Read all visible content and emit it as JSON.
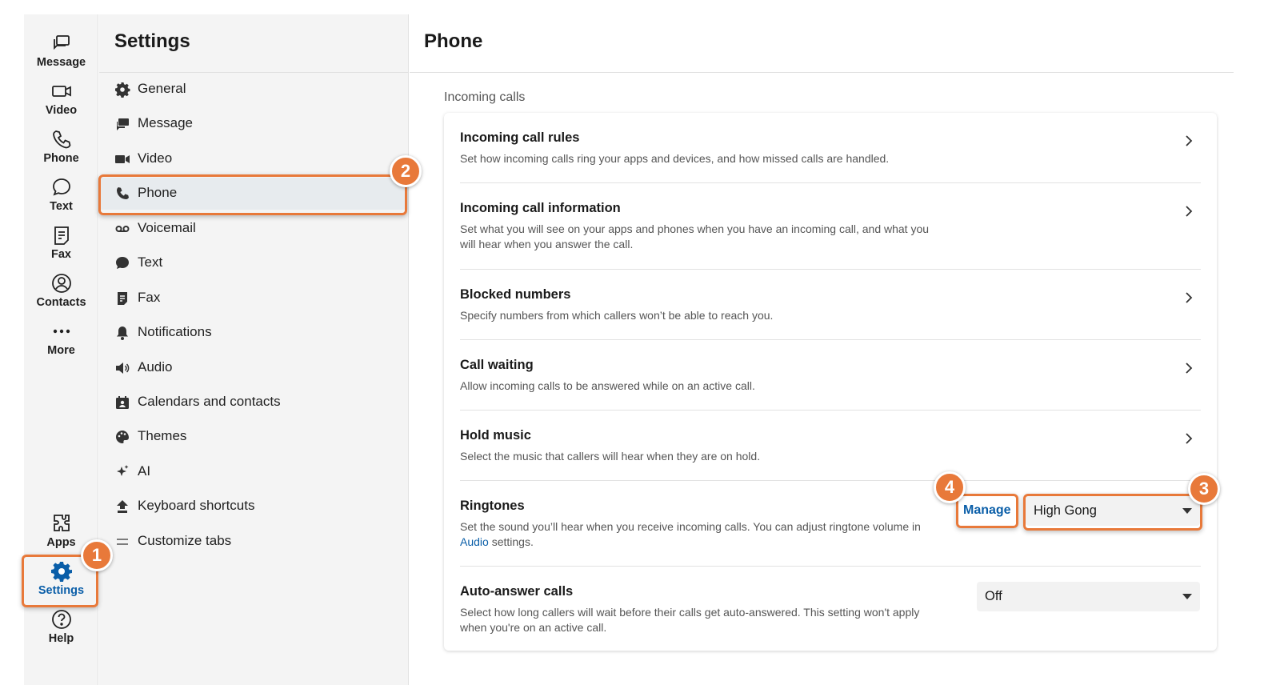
{
  "rail": {
    "items": [
      {
        "label": "Message",
        "icon": "message-icon"
      },
      {
        "label": "Video",
        "icon": "video-icon"
      },
      {
        "label": "Phone",
        "icon": "phone-icon"
      },
      {
        "label": "Text",
        "icon": "text-bubble-icon"
      },
      {
        "label": "Fax",
        "icon": "fax-icon"
      },
      {
        "label": "Contacts",
        "icon": "contacts-icon"
      },
      {
        "label": "More",
        "icon": "more-icon"
      },
      {
        "label": "Apps",
        "icon": "apps-icon"
      },
      {
        "label": "Settings",
        "icon": "settings-gear-icon",
        "active": true
      },
      {
        "label": "Help",
        "icon": "help-icon"
      }
    ]
  },
  "settings": {
    "title": "Settings",
    "items": [
      {
        "label": "General",
        "icon": "gear-icon"
      },
      {
        "label": "Message",
        "icon": "message-icon"
      },
      {
        "label": "Video",
        "icon": "video-icon"
      },
      {
        "label": "Phone",
        "icon": "phone-icon",
        "selected": true
      },
      {
        "label": "Voicemail",
        "icon": "voicemail-icon"
      },
      {
        "label": "Text",
        "icon": "text-bubble-icon"
      },
      {
        "label": "Fax",
        "icon": "fax-icon"
      },
      {
        "label": "Notifications",
        "icon": "bell-icon"
      },
      {
        "label": "Audio",
        "icon": "speaker-icon"
      },
      {
        "label": "Calendars and contacts",
        "icon": "calendar-contact-icon"
      },
      {
        "label": "Themes",
        "icon": "palette-icon"
      },
      {
        "label": "AI",
        "icon": "sparkle-icon"
      },
      {
        "label": "Keyboard shortcuts",
        "icon": "keyboard-shortcut-icon"
      },
      {
        "label": "Customize tabs",
        "icon": "menu-lines-icon"
      }
    ]
  },
  "main": {
    "title": "Phone",
    "section_label": "Incoming calls",
    "rows": [
      {
        "title": "Incoming call rules",
        "desc": "Set how incoming calls ring your apps and devices, and how missed calls are handled."
      },
      {
        "title": "Incoming call information",
        "desc": "Set what you will see on your apps and phones when you have an incoming call, and what you will hear when you answer the call."
      },
      {
        "title": "Blocked numbers",
        "desc": "Specify numbers from which callers won’t be able to reach you."
      },
      {
        "title": "Call waiting",
        "desc": "Allow incoming calls to be answered while on an active call."
      },
      {
        "title": "Hold music",
        "desc": "Select the music that callers will hear when they are on hold."
      }
    ],
    "ringtones": {
      "title": "Ringtones",
      "desc_before": "Set the sound you’ll hear when you receive incoming calls. You can adjust ringtone volume in",
      "desc_link": "Audio",
      "desc_after": "settings.",
      "manage_label": "Manage",
      "selected_value": "High Gong"
    },
    "auto_answer": {
      "title": "Auto-answer calls",
      "desc": "Select how long callers will wait before their calls get auto-answered. This setting won't apply when you're on an active call.",
      "selected_value": "Off"
    }
  },
  "callouts": {
    "badge1": "1",
    "badge2": "2",
    "badge3": "3",
    "badge4": "4",
    "color": "#e8793a"
  },
  "colors": {
    "accent": "#0a5ea8",
    "sidebar_bg": "#f4f4f4",
    "selected_bg": "#e7ebee"
  }
}
